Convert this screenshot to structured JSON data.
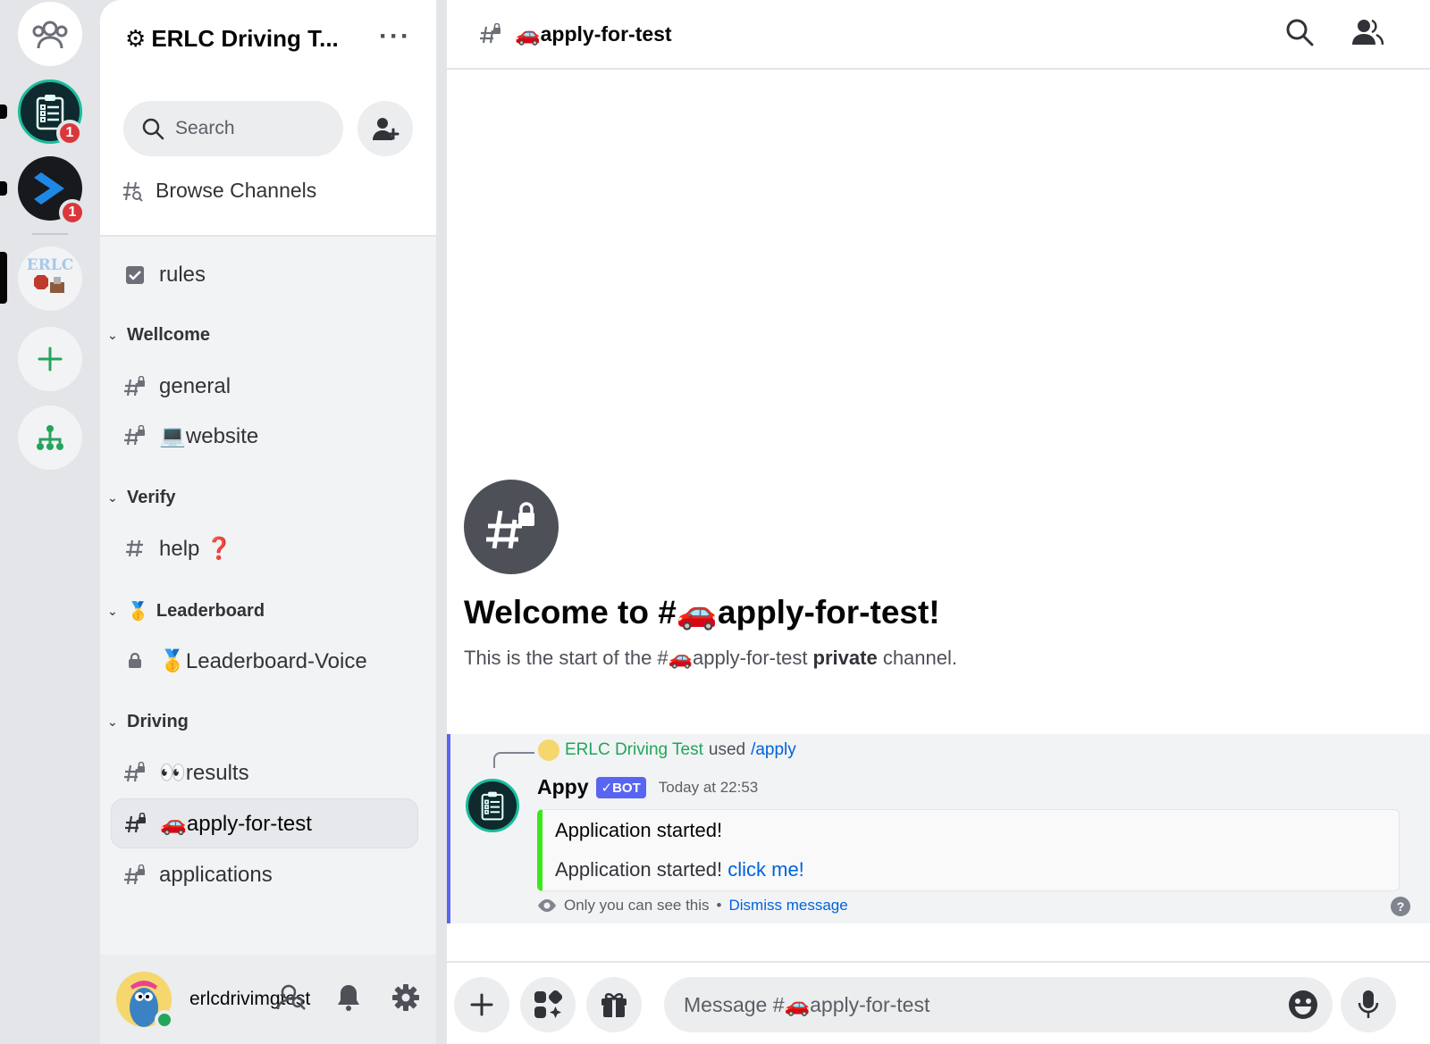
{
  "server": {
    "name": "ERLC Driving T...",
    "search_placeholder": "Search",
    "browse_label": "Browse Channels"
  },
  "rail": {
    "badges": [
      "1",
      "1"
    ],
    "srv3_text": "ERLC"
  },
  "channels": {
    "rules": "rules",
    "categories": {
      "wellcome": "Wellcome",
      "verify": "Verify",
      "leaderboard": "Leaderboard",
      "driving": "Driving"
    },
    "general": "general",
    "website": "website",
    "help": "help",
    "leaderboard_voice": "Leaderboard-Voice",
    "results": "results",
    "apply": "apply-for-test",
    "applications": "applications"
  },
  "emoji": {
    "gear": "⚙",
    "laptop": "💻",
    "question": "❓",
    "medal": "🥇",
    "eyes": "👀",
    "car": "🚗"
  },
  "user": {
    "name": "erlcdrivimgtest"
  },
  "header": {
    "channel": "apply-for-test"
  },
  "welcome": {
    "title": "Welcome to #🚗apply-for-test!",
    "subtitle_start": "This is the start of the #🚗apply-for-test ",
    "subtitle_bold": "private",
    "subtitle_end": " channel."
  },
  "message": {
    "reply_user": "ERLC Driving Test",
    "reply_used": "used",
    "reply_command": "/apply",
    "author": "Appy",
    "bot_tag": "✓BOT",
    "timestamp": "Today at 22:53",
    "embed_title": "Application started!",
    "embed_body": "Application started!",
    "embed_link": "click me!",
    "ephemeral_note": "Only you can see this",
    "separator": "•",
    "dismiss": "Dismiss message",
    "help": "?"
  },
  "composer": {
    "placeholder": "Message #🚗apply-for-test"
  },
  "colors": {
    "accent": "#5865f2",
    "embed_bar": "#3ae81a",
    "online": "#23a55a",
    "badge": "#da373c",
    "link": "#0062d9"
  }
}
